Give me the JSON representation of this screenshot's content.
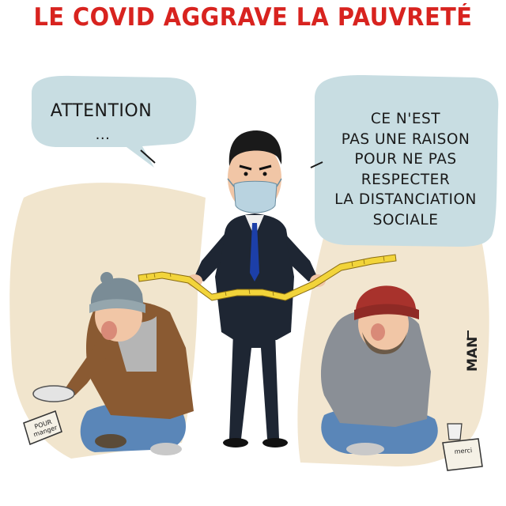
{
  "title": "LE COVID AGGRAVE LA PAUVRETÉ",
  "bubble_left": {
    "text": "ATTENTION",
    "dots": "..."
  },
  "bubble_right": {
    "lines": [
      "CE N'EST",
      "PAS UNE RAISON",
      "POUR NE PAS",
      "RESPECTER",
      "LA DISTANCIATION",
      "SOCIALE"
    ]
  },
  "cardboard_left": {
    "lines": [
      "POUR",
      "manger"
    ]
  },
  "cardboard_right": {
    "text": "merci"
  },
  "signature": "MAN",
  "colors": {
    "title": "#d8231f",
    "bubble_fill": "#c8dde2",
    "background_wash": "#f0e2c8",
    "suit": "#1e2633",
    "tie": "#1c3fa8",
    "mask": "#b9d3e0",
    "tape": "#f2d43a",
    "beanie_red": "#a8322c",
    "beanie_grey": "#7a8c96",
    "hoodie": "#8a8f96",
    "jeans": "#5a86b8",
    "coat_brown": "#8a5a32"
  }
}
